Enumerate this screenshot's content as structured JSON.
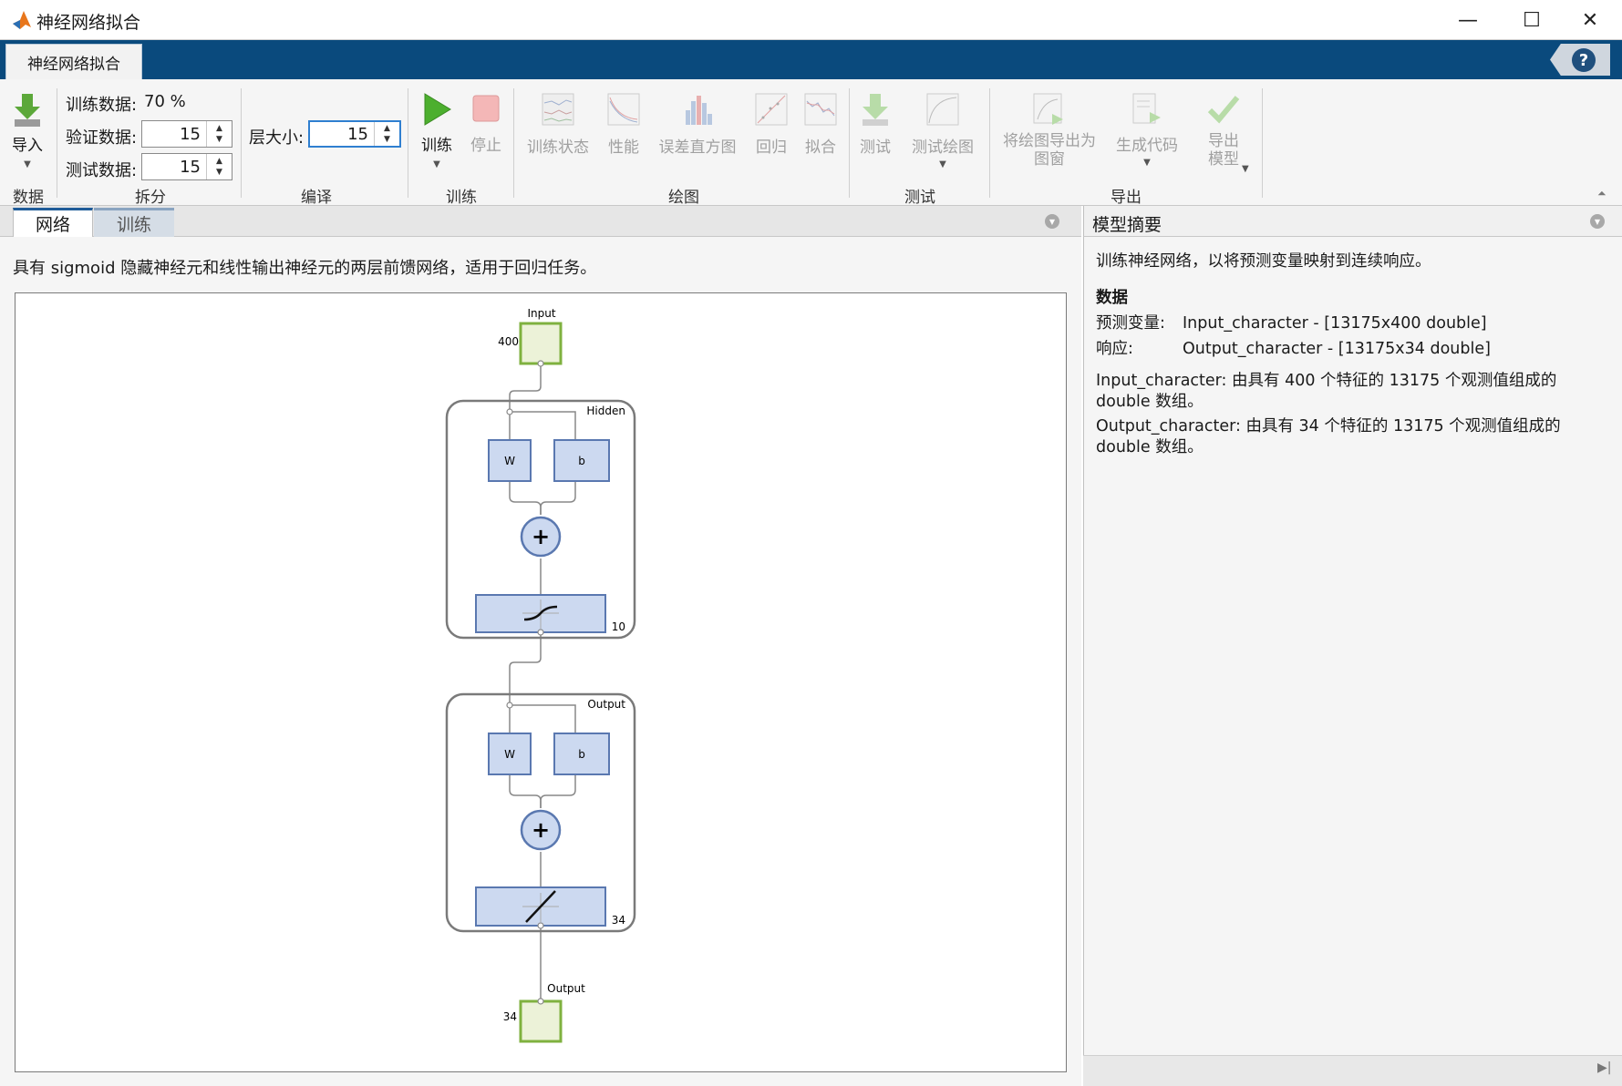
{
  "window": {
    "title": "神经网络拟合",
    "minimize": "—",
    "maximize": "☐",
    "close": "✕",
    "accent": "#0a4a7d"
  },
  "ribbon": {
    "tab": "神经网络拟合",
    "help": "?",
    "data_group": {
      "import_label": "导入",
      "group": "数据"
    },
    "split_group": {
      "train_label": "训练数据:",
      "train_value": "70 %",
      "validation_label": "验证数据:",
      "validation_value": "15",
      "test_label": "测试数据:",
      "test_value": "15",
      "group": "拆分"
    },
    "compile_group": {
      "layer_size_label": "层大小:",
      "layer_size_value": "15",
      "group": "编译"
    },
    "train_group": {
      "train_label": "训练",
      "stop_label": "停止",
      "group": "训练"
    },
    "plot_group": {
      "items": [
        "训练状态",
        "性能",
        "误差直方图",
        "回归",
        "拟合"
      ],
      "group": "绘图"
    },
    "test_group": {
      "test_label": "测试",
      "test_plot_label": "测试绘图",
      "group": "测试"
    },
    "export_group": {
      "export_plot_line1": "将绘图导出为",
      "export_plot_line2": "图窗",
      "gen_code_label": "生成代码",
      "export_model_line1": "导出",
      "export_model_line2": "模型",
      "group": "导出"
    }
  },
  "left_panel": {
    "tabs": [
      "网络",
      "训练"
    ],
    "description": "具有 sigmoid 隐藏神经元和线性输出神经元的两层前馈网络，适用于回归任务。",
    "diagram": {
      "input_label": "Input",
      "input_size": "400",
      "hidden_label": "Hidden",
      "hidden_size": "10",
      "output_layer_label": "Output",
      "output_layer_size": "34",
      "output_label": "Output",
      "output_size": "34",
      "weight_label": "W",
      "bias_label": "b",
      "sum_symbol": "+"
    }
  },
  "right_panel": {
    "title": "模型摘要",
    "intro": "训练神经网络，以将预测变量映射到连续响应。",
    "data_heading": "数据",
    "predictor_label": "预测变量:",
    "predictor_value": "Input_character - [13175x400 double]",
    "response_label": "响应:",
    "response_value": "Output_character - [13175x34 double]",
    "input_desc": "Input_character: 由具有 400 个特征的 13175 个观测值组成的 double 数组。",
    "output_desc": "Output_character: 由具有 34 个特征的 13175 个观测值组成的 double 数组。"
  }
}
